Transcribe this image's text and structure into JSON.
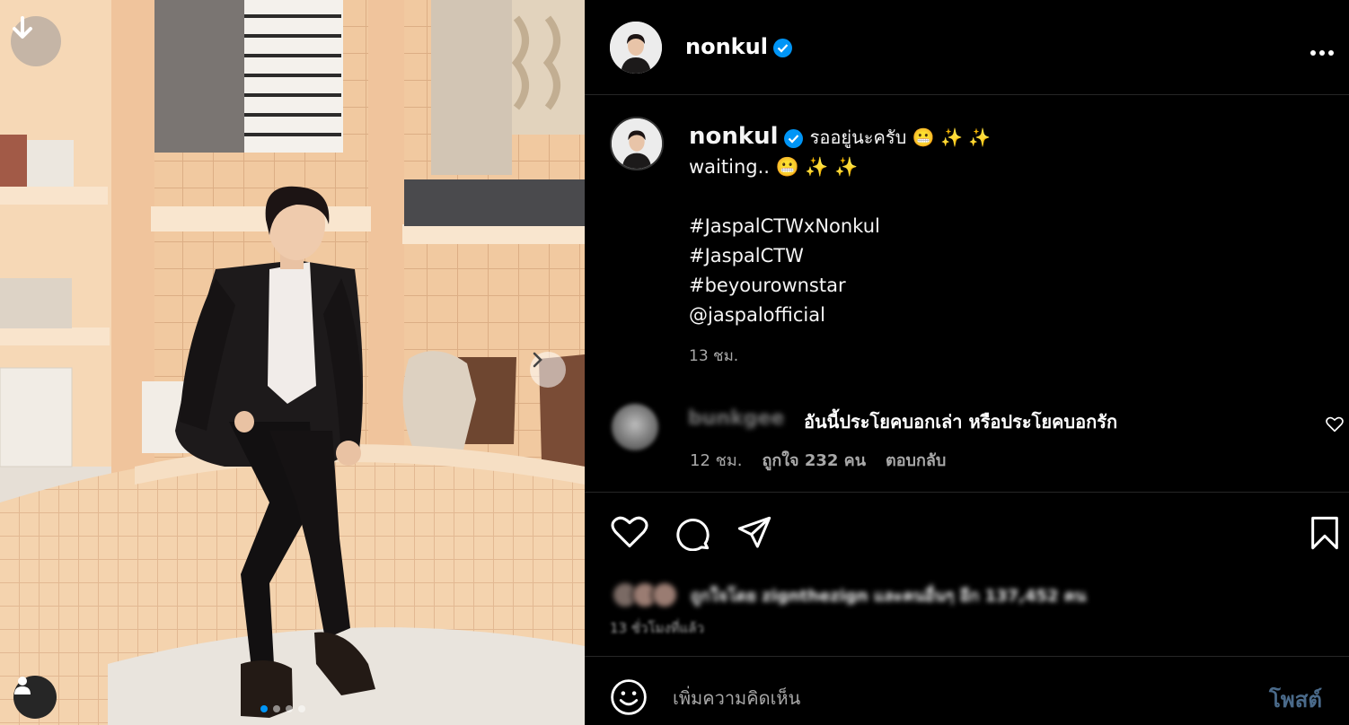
{
  "post": {
    "username": "nonkul",
    "caption_first": "รออยู่นะครับ 😬 ✨ ✨",
    "caption_lines": [
      "waiting.. 😬 ✨ ✨",
      "",
      "#JaspalCTWxNonkul",
      "#JaspalCTW",
      "#beyourownstar",
      "@jaspalofficial"
    ],
    "caption_time": "13 ชม.",
    "carousel": {
      "total": 4,
      "current": 1
    }
  },
  "comment": {
    "username": "bunkgee",
    "text": "อันนี้ประโยคบอกเล่า หรือประโยคบอกรัก",
    "time": "12 ชม.",
    "likes": "ถูกใจ 232 คน",
    "reply": "ตอบกลับ"
  },
  "likes_summary": {
    "text": "ถูกใจโดย zignthezign และคนอื่นๆ อีก 137,452 คน",
    "ago": "13 ชั่วโมงที่แล้ว"
  },
  "composer": {
    "placeholder": "เพิ่มความคิดเห็น",
    "post_label": "โพสต์"
  },
  "icons": {
    "download": "download-arrow-icon",
    "next": "chevron-right-icon",
    "tag": "user-tag-icon",
    "verified": "verified-badge-icon",
    "more": "more-horizontal-icon",
    "like": "heart-icon",
    "comment": "comment-bubble-icon",
    "share": "paper-plane-icon",
    "save": "bookmark-icon",
    "emoji": "emoji-smile-icon"
  },
  "colors": {
    "verified": "#0095f6",
    "secondary_text": "#a8a8a8",
    "post_button": "#4a6a8a"
  }
}
